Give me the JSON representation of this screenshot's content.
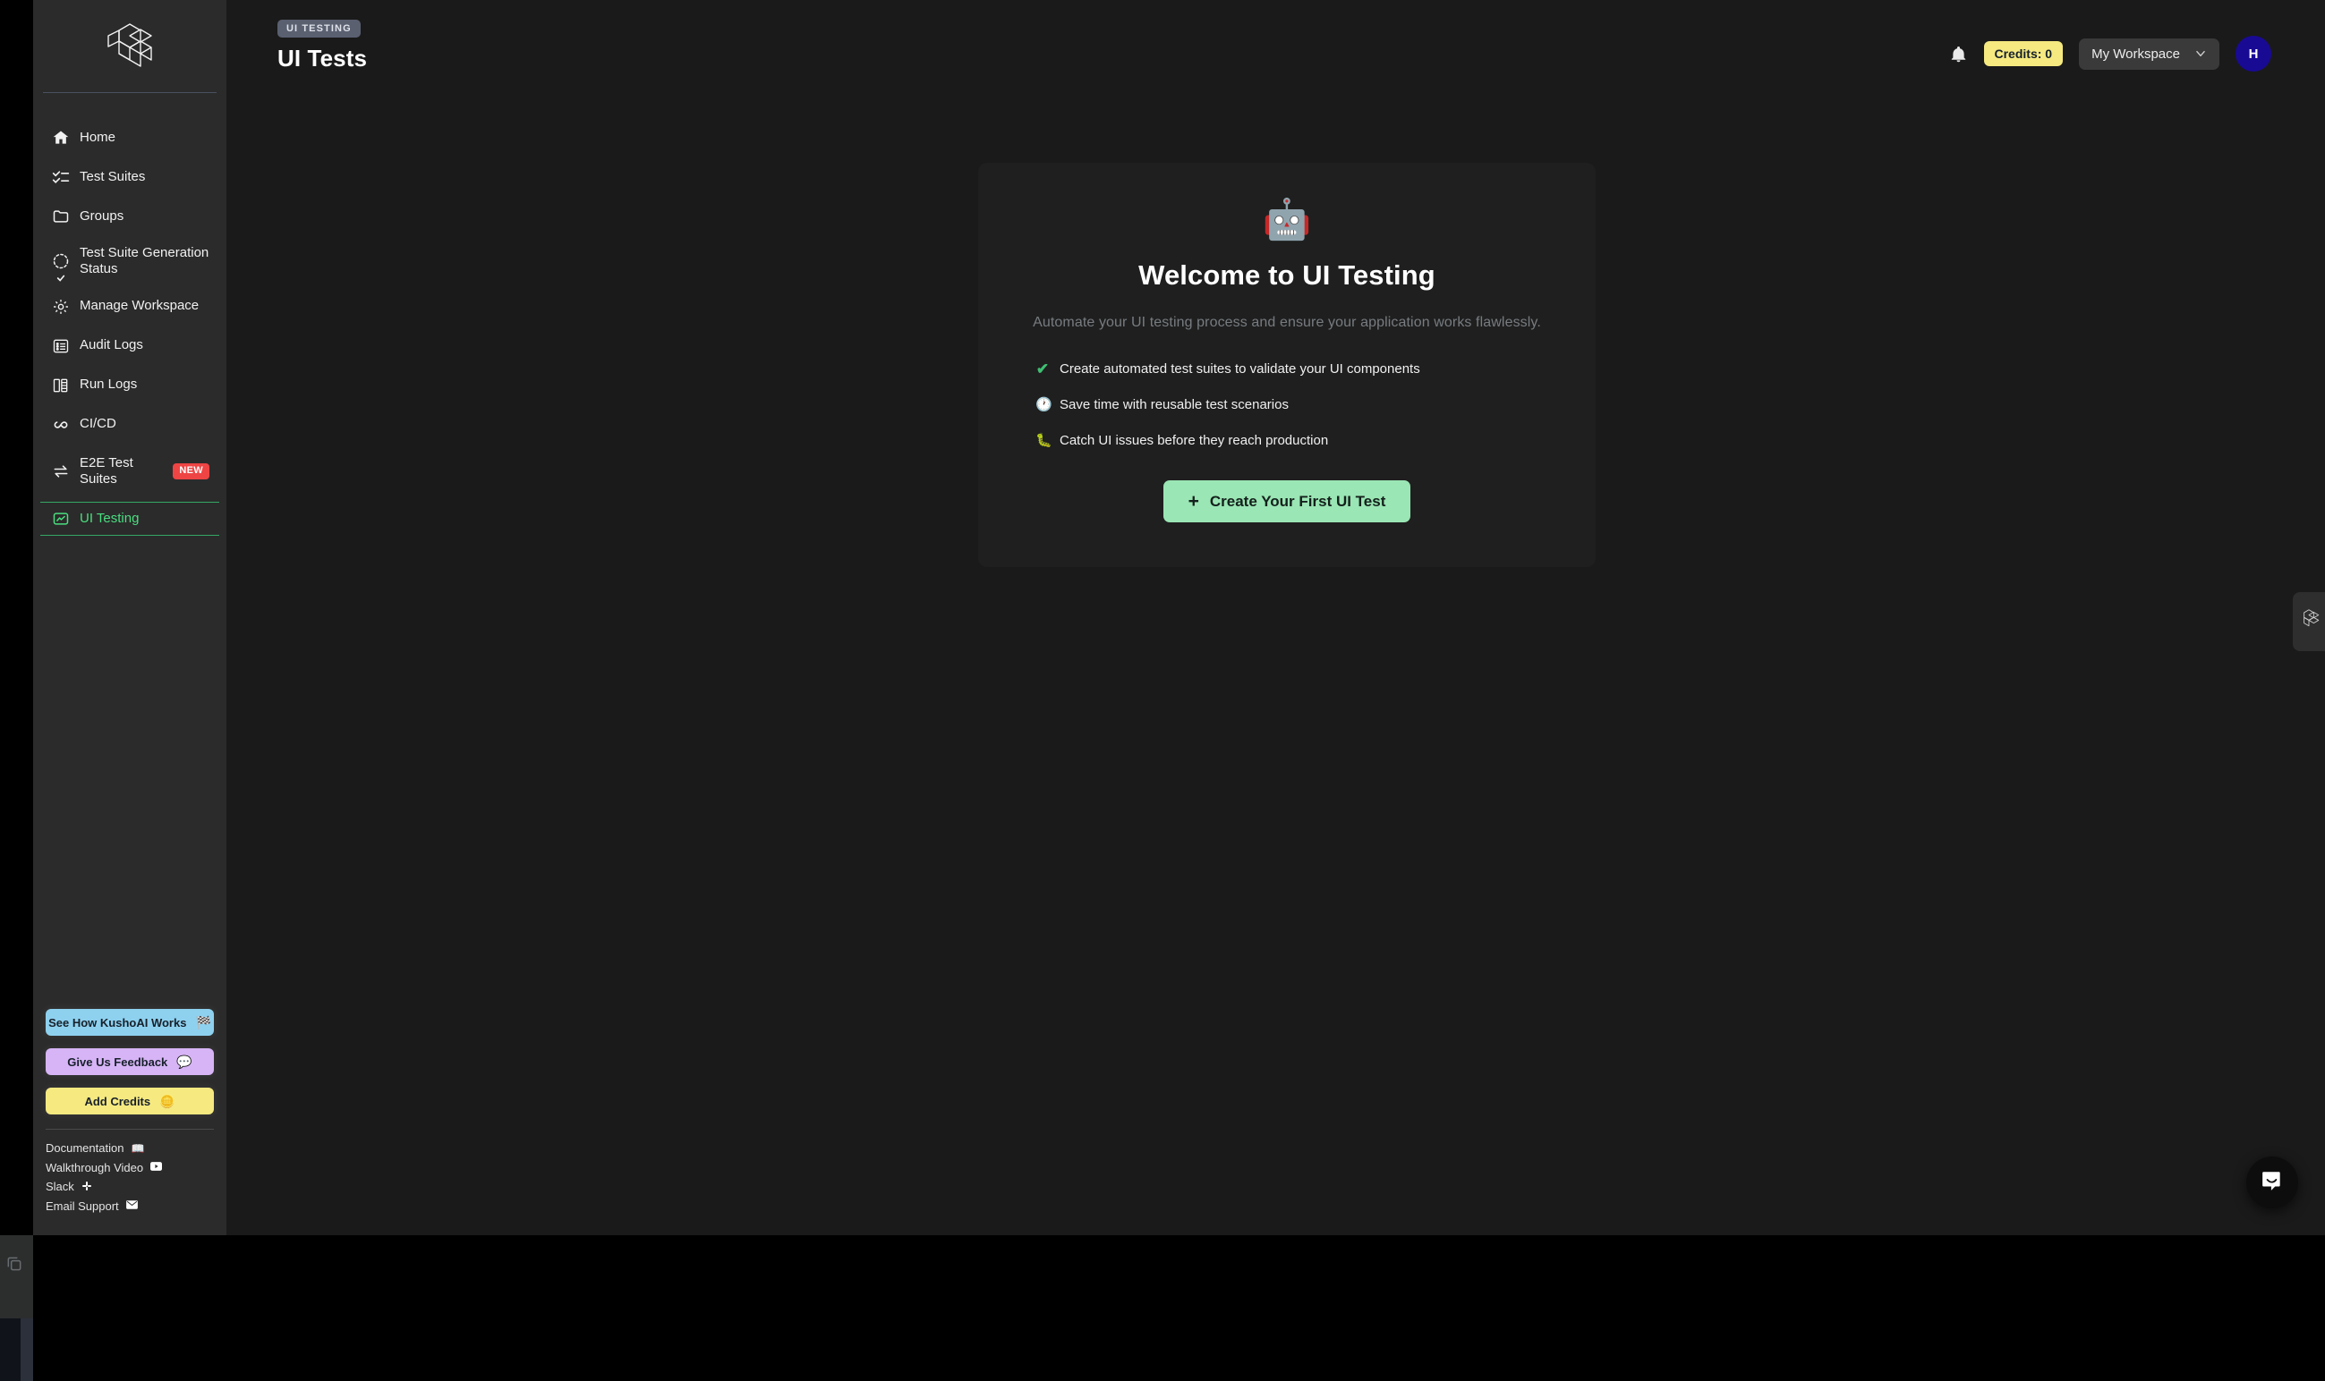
{
  "browser_gutter": {
    "copy_icon_name": "copy-icon"
  },
  "sidebar": {
    "logo_name": "kushoai-logo",
    "items": [
      {
        "label": "Home",
        "icon": "home-icon",
        "active": false
      },
      {
        "label": "Test Suites",
        "icon": "checklist-icon",
        "active": false
      },
      {
        "label": "Groups",
        "icon": "folder-icon",
        "active": false
      },
      {
        "label": "Test Suite Generation Status",
        "icon": "progress-check-icon",
        "active": false
      },
      {
        "label": "Manage Workspace",
        "icon": "gear-icon",
        "active": false
      },
      {
        "label": "Audit Logs",
        "icon": "list-document-icon",
        "active": false
      },
      {
        "label": "Run Logs",
        "icon": "books-icon",
        "active": false
      },
      {
        "label": "CI/CD",
        "icon": "infinity-icon",
        "active": false
      },
      {
        "label": "E2E Test Suites",
        "icon": "arrows-exchange-icon",
        "badge": "NEW",
        "active": false
      },
      {
        "label": "UI Testing",
        "icon": "chart-frame-icon",
        "active": true
      }
    ],
    "ctas": [
      {
        "label": "See How KushoAI Works",
        "emoji": "🏁",
        "color": "#8ed1ef",
        "icon": "checkered-flag-icon"
      },
      {
        "label": "Give Us Feedback",
        "emoji": "💬",
        "color": "#d6b4f5",
        "icon": "speech-bubble-icon"
      },
      {
        "label": "Add Credits",
        "emoji": "🪙",
        "color": "#f5e980",
        "icon": "coins-icon"
      }
    ],
    "links": [
      {
        "label": "Documentation",
        "emoji": "📖",
        "icon": "book-icon"
      },
      {
        "label": "Walkthrough Video",
        "emoji": "▶",
        "icon": "youtube-icon"
      },
      {
        "label": "Slack",
        "emoji": "⁂",
        "icon": "slack-icon"
      },
      {
        "label": "Email Support",
        "emoji": "✉",
        "icon": "envelope-icon"
      }
    ]
  },
  "header": {
    "breadcrumb": "UI TESTING",
    "title": "UI Tests",
    "bell_icon": "bell-icon",
    "credits_label": "Credits: 0",
    "workspace_label": "My Workspace",
    "chevron_icon": "chevron-down-icon",
    "avatar_initial": "H"
  },
  "welcome_card": {
    "robot_emoji": "🤖",
    "title": "Welcome to UI Testing",
    "subtitle": "Automate your UI testing process and ensure your application works flawlessly.",
    "bullets": [
      {
        "icon": "check-icon",
        "glyph": "✔",
        "text": "Create automated test suites to validate your UI components"
      },
      {
        "icon": "clock-icon",
        "glyph": "🕐",
        "text": "Save time with reusable test scenarios"
      },
      {
        "icon": "bug-icon",
        "glyph": "🐛",
        "text": "Catch UI issues before they reach production"
      }
    ],
    "cta_plus": "+",
    "cta_label": "Create Your First UI Test"
  },
  "floating": {
    "side_tab_icon": "kushoai-logo-tab",
    "chat_icon": "intercom-chat-icon"
  },
  "colors": {
    "accent_green": "#9ae6b4",
    "active_green": "#4ade80",
    "credits_yellow": "#f5e980",
    "badge_red": "#ef4444",
    "avatar_indigo": "#190a94",
    "sidebar_bg": "#2b2b2b",
    "main_bg": "#1a1a1a",
    "card_bg": "#1f1f1f"
  }
}
